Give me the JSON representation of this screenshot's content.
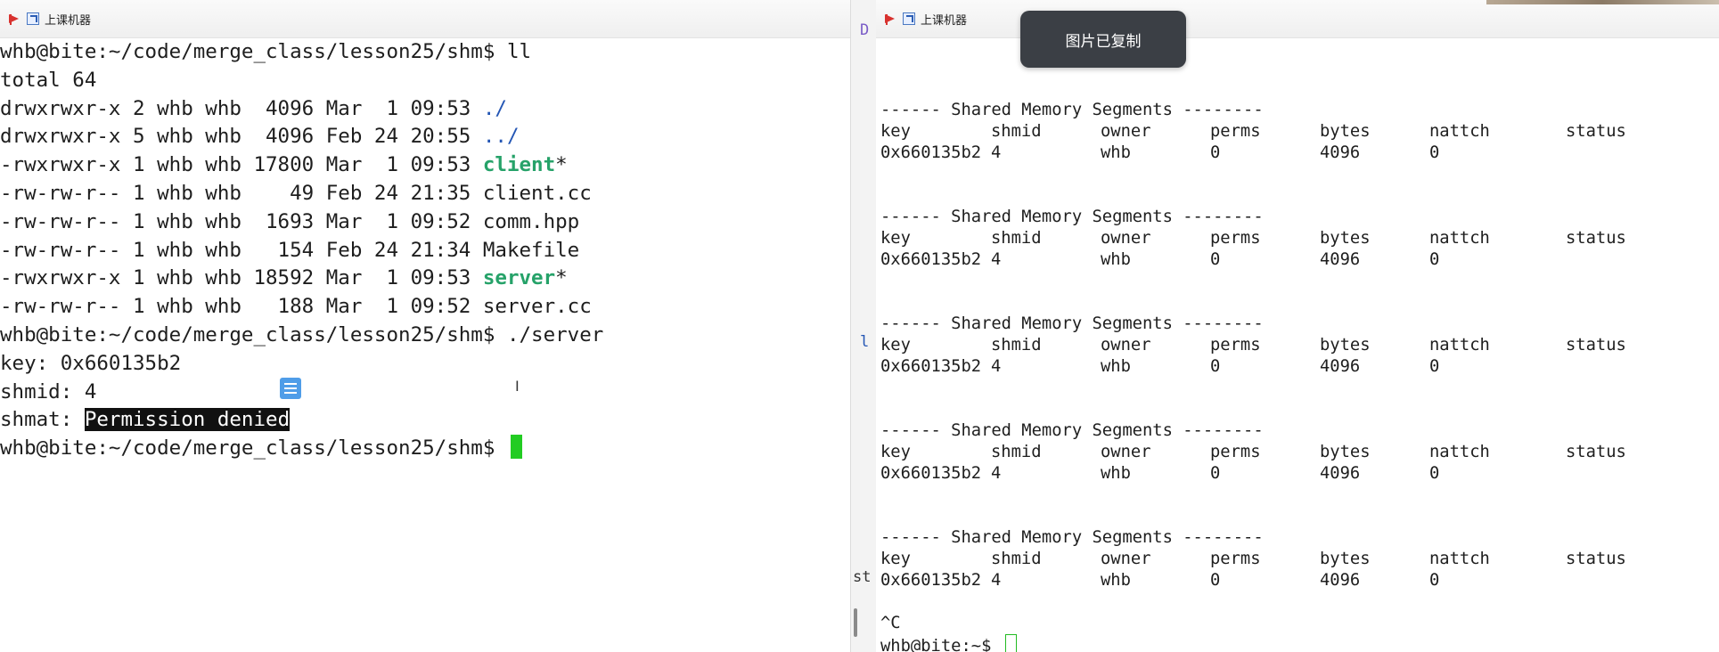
{
  "tabs": {
    "left_title": "上课机器",
    "right_title": "上课机器"
  },
  "toast": {
    "text": "图片已复制"
  },
  "divider": {
    "glyph_top": "D",
    "glyph_mid": "l",
    "glyph_bottom": "st"
  },
  "left_terminal": {
    "lines": [
      {
        "parts": [
          {
            "text": "whb@bite:~/code/merge_class/lesson25/shm$ ll"
          }
        ]
      },
      {
        "parts": [
          {
            "text": "total 64"
          }
        ]
      },
      {
        "parts": [
          {
            "text": "drwxrwxr-x 2 whb whb  4096 Mar  1 09:53 "
          },
          {
            "text": "./",
            "style": "dir"
          }
        ]
      },
      {
        "parts": [
          {
            "text": "drwxrwxr-x 5 whb whb  4096 Feb 24 20:55 "
          },
          {
            "text": "../",
            "style": "dir"
          }
        ]
      },
      {
        "parts": [
          {
            "text": "-rwxrwxr-x 1 whb whb 17800 Mar  1 09:53 "
          },
          {
            "text": "client",
            "style": "exec"
          },
          {
            "text": "*"
          }
        ]
      },
      {
        "parts": [
          {
            "text": "-rw-rw-r-- 1 whb whb    49 Feb 24 21:35 client.cc"
          }
        ]
      },
      {
        "parts": [
          {
            "text": "-rw-rw-r-- 1 whb whb  1693 Mar  1 09:52 comm.hpp"
          }
        ]
      },
      {
        "parts": [
          {
            "text": "-rw-rw-r-- 1 whb whb   154 Feb 24 21:34 Makefile"
          }
        ]
      },
      {
        "parts": [
          {
            "text": "-rwxrwxr-x 1 whb whb 18592 Mar  1 09:53 "
          },
          {
            "text": "server",
            "style": "exec"
          },
          {
            "text": "*"
          }
        ]
      },
      {
        "parts": [
          {
            "text": "-rw-rw-r-- 1 whb whb   188 Mar  1 09:52 server.cc"
          }
        ]
      },
      {
        "parts": [
          {
            "text": "whb@bite:~/code/merge_class/lesson25/shm$ ./server"
          }
        ]
      },
      {
        "parts": [
          {
            "text": "key: 0x660135b2"
          }
        ]
      },
      {
        "parts": [
          {
            "text": "shmid: 4"
          }
        ]
      },
      {
        "parts": [
          {
            "text": "shmat: "
          },
          {
            "text": "Permission denied",
            "style": "hl"
          }
        ]
      },
      {
        "parts": [
          {
            "text": "whb@bite:~/code/merge_class/lesson25/shm$ "
          }
        ],
        "cursor": "solid"
      }
    ]
  },
  "right_terminal": {
    "segment_header": "------ Shared Memory Segments --------",
    "columns": [
      "key",
      "shmid",
      "owner",
      "perms",
      "bytes",
      "nattch",
      "status"
    ],
    "row": [
      "0x660135b2",
      "4",
      "whb",
      "0",
      "4096",
      "0",
      ""
    ],
    "repeat_count": 5,
    "interrupt": "^C",
    "prompt": "whb@bite:~$ "
  }
}
